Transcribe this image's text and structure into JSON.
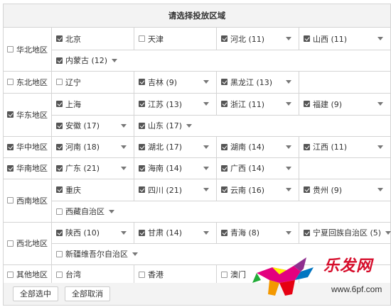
{
  "title": "请选择投放区域",
  "regions": [
    {
      "name": "华北地区",
      "checked": false,
      "provinces": [
        {
          "label": "北京",
          "checked": true,
          "dd": false
        },
        {
          "label": "天津",
          "checked": false,
          "dd": false
        },
        {
          "label": "河北 (11)",
          "checked": true,
          "dd": true
        },
        {
          "label": "山西 (11)",
          "checked": true,
          "dd": true
        },
        {
          "label": "内蒙古 (12)",
          "checked": true,
          "dd": true
        }
      ]
    },
    {
      "name": "东北地区",
      "checked": false,
      "provinces": [
        {
          "label": "辽宁",
          "checked": false,
          "dd": false
        },
        {
          "label": "吉林 (9)",
          "checked": true,
          "dd": true
        },
        {
          "label": "黑龙江 (13)",
          "checked": true,
          "dd": true
        }
      ]
    },
    {
      "name": "华东地区",
      "checked": true,
      "provinces": [
        {
          "label": "上海",
          "checked": true,
          "dd": false
        },
        {
          "label": "江苏 (13)",
          "checked": true,
          "dd": true
        },
        {
          "label": "浙江 (11)",
          "checked": true,
          "dd": true
        },
        {
          "label": "福建 (9)",
          "checked": true,
          "dd": true
        },
        {
          "label": "安徽 (17)",
          "checked": true,
          "dd": true
        },
        {
          "label": "山东 (17)",
          "checked": true,
          "dd": true
        }
      ]
    },
    {
      "name": "华中地区",
      "checked": true,
      "provinces": [
        {
          "label": "河南 (18)",
          "checked": true,
          "dd": true
        },
        {
          "label": "湖北 (17)",
          "checked": true,
          "dd": true
        },
        {
          "label": "湖南 (14)",
          "checked": true,
          "dd": true
        },
        {
          "label": "江西 (11)",
          "checked": true,
          "dd": true
        }
      ]
    },
    {
      "name": "华南地区",
      "checked": true,
      "provinces": [
        {
          "label": "广东 (21)",
          "checked": true,
          "dd": true
        },
        {
          "label": "海南 (14)",
          "checked": true,
          "dd": true
        },
        {
          "label": "广西 (14)",
          "checked": true,
          "dd": true
        }
      ]
    },
    {
      "name": "西南地区",
      "checked": false,
      "provinces": [
        {
          "label": "重庆",
          "checked": true,
          "dd": false
        },
        {
          "label": "四川 (21)",
          "checked": true,
          "dd": true
        },
        {
          "label": "云南 (16)",
          "checked": true,
          "dd": true
        },
        {
          "label": "贵州 (9)",
          "checked": true,
          "dd": true
        },
        {
          "label": "西藏自治区",
          "checked": false,
          "dd": true
        }
      ]
    },
    {
      "name": "西北地区",
      "checked": false,
      "provinces": [
        {
          "label": "陕西 (10)",
          "checked": true,
          "dd": true
        },
        {
          "label": "甘肃 (14)",
          "checked": true,
          "dd": true
        },
        {
          "label": "青海 (8)",
          "checked": true,
          "dd": true
        },
        {
          "label": "宁夏回族自治区 (5)",
          "checked": true,
          "dd": true
        },
        {
          "label": "新疆维吾尔自治区",
          "checked": false,
          "dd": true
        }
      ]
    },
    {
      "name": "其他地区",
      "checked": false,
      "provinces": [
        {
          "label": "台湾",
          "checked": false,
          "dd": false
        },
        {
          "label": "香港",
          "checked": false,
          "dd": false
        },
        {
          "label": "澳门",
          "checked": false,
          "dd": false
        }
      ]
    }
  ],
  "buttons": {
    "select_all": "全部选中",
    "cancel_all": "全部取消"
  },
  "watermark": {
    "text": "乐发网",
    "url": "www.6pf.com"
  },
  "colors": {
    "border": "#d4d4d4",
    "header_bg": "#f3f3f3",
    "checkbox_checked": "#555555",
    "watermark_red": "#d60d2b"
  }
}
